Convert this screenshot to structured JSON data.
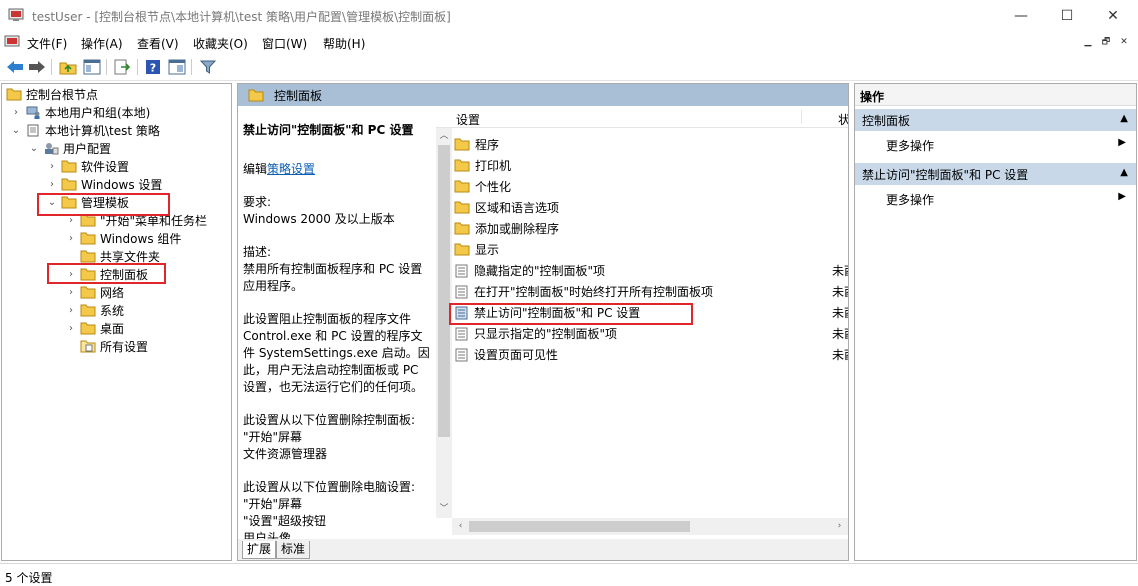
{
  "window": {
    "title": "testUser - [控制台根节点\\本地计算机\\test 策略\\用户配置\\管理模板\\控制面板]",
    "minimize_glyph": "—",
    "maximize_glyph": "☐",
    "close_glyph": "✕"
  },
  "menu": {
    "items": [
      "文件(F)",
      "操作(A)",
      "查看(V)",
      "收藏夹(O)",
      "窗口(W)",
      "帮助(H)"
    ],
    "mdi_buttons": [
      "▁",
      "🗗",
      "✕"
    ]
  },
  "toolbar": {
    "buttons": [
      "back-arrow-icon",
      "forward-arrow-icon",
      "up-folder-icon",
      "show-hide-tree-icon",
      "export-list-icon",
      "help-icon",
      "properties-icon",
      "filter-icon"
    ]
  },
  "tree": {
    "items": [
      {
        "label": "控制台根节点",
        "icon": "folder-icon",
        "arrow": ""
      },
      {
        "label": "本地用户和组(本地)",
        "icon": "users-icon",
        "arrow": "›"
      },
      {
        "label": "本地计算机\\test 策略",
        "icon": "policy-icon",
        "arrow": "⌄"
      },
      {
        "label": "用户配置",
        "icon": "user-config-icon",
        "arrow": "⌄"
      },
      {
        "label": "软件设置",
        "icon": "folder-icon",
        "arrow": "›"
      },
      {
        "label": "Windows 设置",
        "icon": "folder-icon",
        "arrow": "›"
      },
      {
        "label": "管理模板",
        "icon": "folder-icon",
        "arrow": "⌄"
      },
      {
        "label": "\"开始\"菜单和任务栏",
        "icon": "folder-icon",
        "arrow": "›"
      },
      {
        "label": "Windows 组件",
        "icon": "folder-icon",
        "arrow": "›"
      },
      {
        "label": "共享文件夹",
        "icon": "folder-icon",
        "arrow": ""
      },
      {
        "label": "控制面板",
        "icon": "folder-icon",
        "arrow": "›"
      },
      {
        "label": "网络",
        "icon": "folder-icon",
        "arrow": "›"
      },
      {
        "label": "系统",
        "icon": "folder-icon",
        "arrow": "›"
      },
      {
        "label": "桌面",
        "icon": "folder-icon",
        "arrow": "›"
      },
      {
        "label": "所有设置",
        "icon": "all-settings-icon",
        "arrow": ""
      }
    ]
  },
  "center": {
    "header": "控制面板",
    "description": {
      "title": "禁止访问\"控制面板\"和 PC 设置",
      "edit_prefix": "编辑",
      "edit_link": "策略设置",
      "requirement_label": "要求:",
      "requirement": "Windows 2000 及以上版本",
      "desc_label": "描述:",
      "desc_lines": [
        "禁用所有控制面板程序和 PC 设置",
        "应用程序。"
      ],
      "para1": [
        "此设置阻止控制面板的程序文件",
        "Control.exe 和 PC 设置的程序文",
        "件 SystemSettings.exe 启动。因",
        "此，用户无法启动控制面板或 PC",
        "设置，也无法运行它们的任何项。"
      ],
      "para2": [
        "此设置从以下位置删除控制面板:",
        "\"开始\"屏幕",
        "文件资源管理器"
      ],
      "para3": [
        "此设置从以下位置删除电脑设置:",
        "\"开始\"屏幕",
        "\"设置\"超级按钮",
        "用户头像"
      ]
    },
    "list": {
      "col_setting": "设置",
      "col_state": "状",
      "rows": [
        {
          "label": "程序",
          "type": "folder",
          "state": ""
        },
        {
          "label": "打印机",
          "type": "folder",
          "state": ""
        },
        {
          "label": "个性化",
          "type": "folder",
          "state": ""
        },
        {
          "label": "区域和语言选项",
          "type": "folder",
          "state": ""
        },
        {
          "label": "添加或删除程序",
          "type": "folder",
          "state": ""
        },
        {
          "label": "显示",
          "type": "folder",
          "state": ""
        },
        {
          "label": "隐藏指定的\"控制面板\"项",
          "type": "setting",
          "state": "未酉"
        },
        {
          "label": "在打开\"控制面板\"时始终打开所有控制面板项",
          "type": "setting",
          "state": "未酉"
        },
        {
          "label": "禁止访问\"控制面板\"和 PC 设置",
          "type": "setting",
          "state": "未酉"
        },
        {
          "label": "只显示指定的\"控制面板\"项",
          "type": "setting",
          "state": "未酉"
        },
        {
          "label": "设置页面可见性",
          "type": "setting",
          "state": "未酉"
        }
      ]
    },
    "tabs": [
      "扩展",
      "标准"
    ]
  },
  "actions": {
    "title": "操作",
    "sections": [
      {
        "header": "控制面板",
        "item": "更多操作"
      },
      {
        "header": "禁止访问\"控制面板\"和 PC 设置",
        "item": "更多操作"
      }
    ]
  },
  "status": {
    "text": "5 个设置"
  },
  "colors": {
    "highlight_red": "#e0262a",
    "header_blue": "#a9bfd6",
    "action_section": "#c8d8e8",
    "folder_yellow": "#f4c94a",
    "link_blue": "#0a5fb4"
  }
}
